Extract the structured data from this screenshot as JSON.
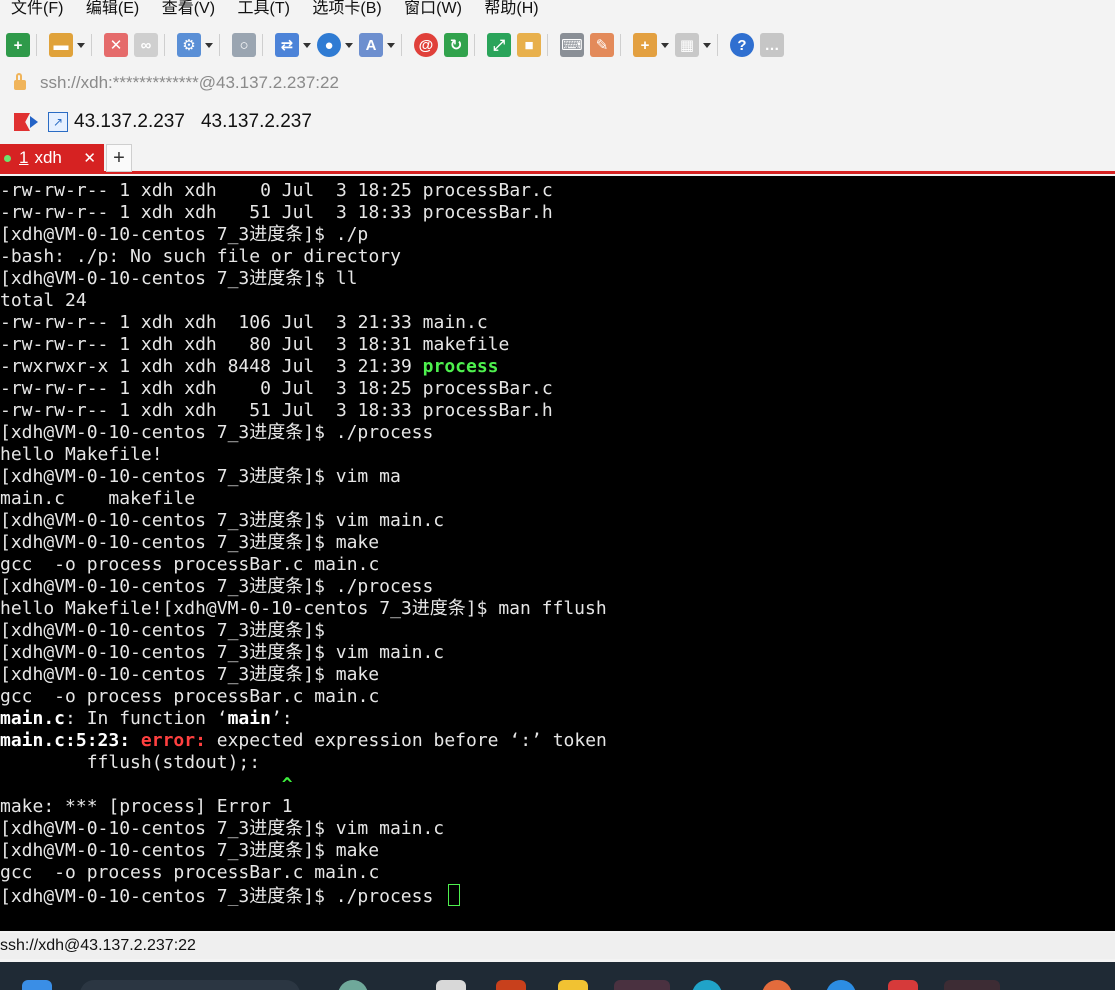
{
  "menu": [
    "文件(F)",
    "编辑(E)",
    "查看(V)",
    "工具(T)",
    "选项卡(B)",
    "窗口(W)",
    "帮助(H)"
  ],
  "address": "ssh://xdh:*************@43.137.2.237:22",
  "bookmark": {
    "label_1": "43.137.2.237",
    "label_2": "43.137.2.237"
  },
  "tab": {
    "number": "1",
    "title": "xdh",
    "close": "✕",
    "new": "+"
  },
  "terminal": {
    "lines": [
      "-rw-rw-r-- 1 xdh xdh    0 Jul  3 18:25 processBar.c",
      "-rw-rw-r-- 1 xdh xdh   51 Jul  3 18:33 processBar.h",
      "[xdh@VM-0-10-centos 7_3进度条]$ ./p",
      "-bash: ./p: No such file or directory",
      "[xdh@VM-0-10-centos 7_3进度条]$ ll",
      "total 24",
      "-rw-rw-r-- 1 xdh xdh  106 Jul  3 21:33 main.c",
      "-rw-rw-r-- 1 xdh xdh   80 Jul  3 18:31 makefile",
      "-rwxrwxr-x 1 xdh xdh 8448 Jul  3 21:39 ",
      "-rw-rw-r-- 1 xdh xdh    0 Jul  3 18:25 processBar.c",
      "-rw-rw-r-- 1 xdh xdh   51 Jul  3 18:33 processBar.h",
      "[xdh@VM-0-10-centos 7_3进度条]$ ./process",
      "hello Makefile!",
      "[xdh@VM-0-10-centos 7_3进度条]$ vim ma",
      "main.c    makefile",
      "[xdh@VM-0-10-centos 7_3进度条]$ vim main.c",
      "[xdh@VM-0-10-centos 7_3进度条]$ make",
      "gcc  -o process processBar.c main.c",
      "[xdh@VM-0-10-centos 7_3进度条]$ ./process",
      "hello Makefile![xdh@VM-0-10-centos 7_3进度条]$ man fflush",
      "[xdh@VM-0-10-centos 7_3进度条]$",
      "[xdh@VM-0-10-centos 7_3进度条]$ vim main.c",
      "[xdh@VM-0-10-centos 7_3进度条]$ make",
      "gcc  -o process processBar.c main.c",
      "",
      "",
      "        fflush(stdout);:",
      "",
      "make: *** [process] Error 1",
      "[xdh@VM-0-10-centos 7_3进度条]$ vim main.c",
      "[xdh@VM-0-10-centos 7_3进度条]$ make",
      "gcc  -o process processBar.c main.c",
      "[xdh@VM-0-10-centos 7_3进度条]$ ./process "
    ],
    "exec_name": "process",
    "diag1": {
      "file": "main.c",
      "mid": ": In function ‘",
      "func": "main",
      "end": "’:"
    },
    "diag2": {
      "loc": "main.c:5:23:",
      "sp1": " ",
      "err": "error:",
      "msg": " expected expression before ‘:’ token"
    },
    "caret_line": "                          ^"
  },
  "status": "ssh://xdh@43.137.2.237:22",
  "colors": {
    "tab_red": "#d62222",
    "terminal_bg": "#000000",
    "exec_green": "#4ef04e",
    "error_red": "#ff4040"
  }
}
